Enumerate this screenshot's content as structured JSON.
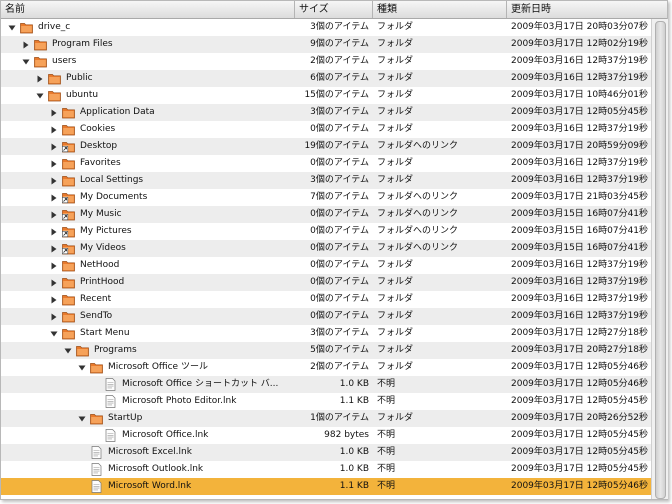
{
  "columns": {
    "name": "名前",
    "size": "サイズ",
    "kind": "種類",
    "date": "更新日時"
  },
  "colors": {
    "folder": "#e97a2c",
    "selection": "#f3b33b",
    "alt_row": "#ededed"
  },
  "rows": [
    {
      "depth": 0,
      "expander": "open",
      "icon": "folder-icon",
      "name": "drive_c",
      "size": "3個のアイテム",
      "kind": "フォルダ",
      "date": "2009年03月17日 20時03分07秒"
    },
    {
      "depth": 1,
      "expander": "closed",
      "icon": "folder-icon",
      "name": "Program Files",
      "size": "9個のアイテム",
      "kind": "フォルダ",
      "date": "2009年03月17日 12時02分19秒"
    },
    {
      "depth": 1,
      "expander": "open",
      "icon": "folder-icon",
      "name": "users",
      "size": "2個のアイテム",
      "kind": "フォルダ",
      "date": "2009年03月16日 12時37分19秒"
    },
    {
      "depth": 2,
      "expander": "closed",
      "icon": "folder-icon",
      "name": "Public",
      "size": "6個のアイテム",
      "kind": "フォルダ",
      "date": "2009年03月16日 12時37分19秒"
    },
    {
      "depth": 2,
      "expander": "open",
      "icon": "folder-icon",
      "name": "ubuntu",
      "size": "15個のアイテム",
      "kind": "フォルダ",
      "date": "2009年03月17日 10時46分01秒"
    },
    {
      "depth": 3,
      "expander": "closed",
      "icon": "folder-icon",
      "name": "Application Data",
      "size": "3個のアイテム",
      "kind": "フォルダ",
      "date": "2009年03月17日 12時05分45秒"
    },
    {
      "depth": 3,
      "expander": "closed",
      "icon": "folder-icon",
      "name": "Cookies",
      "size": "0個のアイテム",
      "kind": "フォルダ",
      "date": "2009年03月16日 12時37分19秒"
    },
    {
      "depth": 3,
      "expander": "closed",
      "icon": "folder-link-icon",
      "name": "Desktop",
      "size": "19個のアイテム",
      "kind": "フォルダへのリンク",
      "date": "2009年03月17日 20時59分09秒"
    },
    {
      "depth": 3,
      "expander": "closed",
      "icon": "folder-icon",
      "name": "Favorites",
      "size": "0個のアイテム",
      "kind": "フォルダ",
      "date": "2009年03月16日 12時37分19秒"
    },
    {
      "depth": 3,
      "expander": "closed",
      "icon": "folder-icon",
      "name": "Local Settings",
      "size": "3個のアイテム",
      "kind": "フォルダ",
      "date": "2009年03月16日 12時37分19秒"
    },
    {
      "depth": 3,
      "expander": "closed",
      "icon": "folder-link-icon",
      "name": "My Documents",
      "size": "7個のアイテム",
      "kind": "フォルダへのリンク",
      "date": "2009年03月17日 21時03分45秒"
    },
    {
      "depth": 3,
      "expander": "closed",
      "icon": "folder-link-icon",
      "name": "My Music",
      "size": "0個のアイテム",
      "kind": "フォルダへのリンク",
      "date": "2009年03月15日 16時07分41秒"
    },
    {
      "depth": 3,
      "expander": "closed",
      "icon": "folder-link-icon",
      "name": "My Pictures",
      "size": "0個のアイテム",
      "kind": "フォルダへのリンク",
      "date": "2009年03月15日 16時07分41秒"
    },
    {
      "depth": 3,
      "expander": "closed",
      "icon": "folder-link-icon",
      "name": "My Videos",
      "size": "0個のアイテム",
      "kind": "フォルダへのリンク",
      "date": "2009年03月15日 16時07分41秒"
    },
    {
      "depth": 3,
      "expander": "closed",
      "icon": "folder-icon",
      "name": "NetHood",
      "size": "0個のアイテム",
      "kind": "フォルダ",
      "date": "2009年03月16日 12時37分19秒"
    },
    {
      "depth": 3,
      "expander": "closed",
      "icon": "folder-icon",
      "name": "PrintHood",
      "size": "0個のアイテム",
      "kind": "フォルダ",
      "date": "2009年03月16日 12時37分19秒"
    },
    {
      "depth": 3,
      "expander": "closed",
      "icon": "folder-icon",
      "name": "Recent",
      "size": "0個のアイテム",
      "kind": "フォルダ",
      "date": "2009年03月16日 12時37分19秒"
    },
    {
      "depth": 3,
      "expander": "closed",
      "icon": "folder-icon",
      "name": "SendTo",
      "size": "0個のアイテム",
      "kind": "フォルダ",
      "date": "2009年03月16日 12時37分19秒"
    },
    {
      "depth": 3,
      "expander": "open",
      "icon": "folder-icon",
      "name": "Start Menu",
      "size": "3個のアイテム",
      "kind": "フォルダ",
      "date": "2009年03月17日 12時27分18秒"
    },
    {
      "depth": 4,
      "expander": "open",
      "icon": "folder-icon",
      "name": "Programs",
      "size": "5個のアイテム",
      "kind": "フォルダ",
      "date": "2009年03月17日 20時27分18秒"
    },
    {
      "depth": 5,
      "expander": "open",
      "icon": "folder-icon",
      "name": "Microsoft Office ツール",
      "size": "2個のアイテム",
      "kind": "フォルダ",
      "date": "2009年03月17日 12時05分46秒"
    },
    {
      "depth": 6,
      "expander": "none",
      "icon": "document-icon",
      "name": "Microsoft Office ショートカット バ...",
      "size": "1.0 KB",
      "kind": "不明",
      "date": "2009年03月17日 12時05分46秒"
    },
    {
      "depth": 6,
      "expander": "none",
      "icon": "document-icon",
      "name": "Microsoft Photo Editor.lnk",
      "size": "1.1 KB",
      "kind": "不明",
      "date": "2009年03月17日 12時05分45秒"
    },
    {
      "depth": 5,
      "expander": "open",
      "icon": "folder-icon",
      "name": "StartUp",
      "size": "1個のアイテム",
      "kind": "フォルダ",
      "date": "2009年03月17日 20時26分52秒"
    },
    {
      "depth": 6,
      "expander": "none",
      "icon": "document-icon",
      "name": "Microsoft Office.lnk",
      "size": "982 bytes",
      "kind": "不明",
      "date": "2009年03月17日 12時05分45秒"
    },
    {
      "depth": 5,
      "expander": "none",
      "icon": "document-icon",
      "name": "Microsoft Excel.lnk",
      "size": "1.0 KB",
      "kind": "不明",
      "date": "2009年03月17日 12時05分45秒"
    },
    {
      "depth": 5,
      "expander": "none",
      "icon": "document-icon",
      "name": "Microsoft Outlook.lnk",
      "size": "1.0 KB",
      "kind": "不明",
      "date": "2009年03月17日 12時05分45秒"
    },
    {
      "depth": 5,
      "expander": "none",
      "icon": "document-icon",
      "name": "Microsoft Word.lnk",
      "size": "1.1 KB",
      "kind": "不明",
      "date": "2009年03月17日 12時05分46秒",
      "selected": true
    }
  ]
}
